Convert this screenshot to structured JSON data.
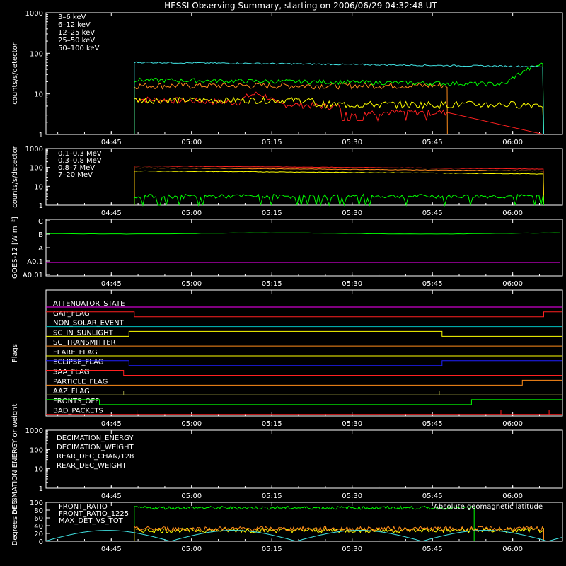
{
  "page": {
    "title": "HESSI Observing Summary, starting on 2006/06/29 04:32:48 UT"
  },
  "time_axis": {
    "range_minutes_after_0432": [
      0,
      96.5
    ],
    "ticks": [
      "04:45",
      "05:00",
      "05:15",
      "05:30",
      "05:45",
      "06:00"
    ],
    "tick_minutes": [
      12.2,
      27.2,
      42.2,
      57.2,
      72.2,
      87.2
    ]
  },
  "chart_data": [
    {
      "id": "hxr",
      "type": "line",
      "ylabel": "counts/s/detector",
      "yscale": "log",
      "ylim": [
        1,
        1000
      ],
      "yticks": [
        "1",
        "10",
        "100",
        "1000"
      ],
      "series": [
        {
          "name": "3–6 keV",
          "color": "#ff2020",
          "kind": "hxr_low"
        },
        {
          "name": "6–12 keV",
          "color": "#ff8c1a",
          "kind": "flat",
          "level": 16,
          "end": 75
        },
        {
          "name": "12–25 keV",
          "color": "#ffff00",
          "kind": "flat",
          "level": 7,
          "end": 93
        },
        {
          "name": "25–50 keV",
          "color": "#00ff00",
          "kind": "rise",
          "level": 22,
          "end": 93,
          "final": 60
        },
        {
          "name": "50–100 keV",
          "color": "#40e0e0",
          "kind": "decline",
          "level": 60,
          "final": 47,
          "end": 93
        }
      ],
      "data_start_minute": 16.5
    },
    {
      "id": "gamma",
      "type": "line",
      "ylabel": "counts/s/detector",
      "yscale": "log",
      "ylim": [
        1,
        1000
      ],
      "yticks": [
        "1",
        "10",
        "100",
        "1000"
      ],
      "series": [
        {
          "name": "0.1–0.3 MeV",
          "color": "#ff2020",
          "level": 120,
          "final": 82
        },
        {
          "name": "0.3–0.8 MeV",
          "color": "#ff8c1a",
          "level": 95,
          "final": 65
        },
        {
          "name": "0.8–7 MeV",
          "color": "#ffff00",
          "level": 65,
          "final": 45
        },
        {
          "name": "7–20 MeV",
          "color": "#00ff00",
          "level": 3,
          "final": 3
        }
      ],
      "data_start_minute": 16.5,
      "data_end_minute": 93
    },
    {
      "id": "goes",
      "type": "line",
      "ylabel": "GOES-12 [W m⁻²]",
      "yticks": [
        "C",
        "B",
        "A",
        "A0.1",
        "A0.01"
      ],
      "series": [
        {
          "name": "long",
          "color": "#00ff00",
          "level_class": 4.9
        },
        {
          "name": "short",
          "color": "#ff00ff",
          "level_class": 2.1
        }
      ]
    },
    {
      "id": "flags",
      "type": "line",
      "ylabel": "Flags",
      "series": [
        {
          "name": "ATTENUATOR_STATE",
          "color": "#ff00ff",
          "segments": [
            [
              0,
              96.5,
              0
            ]
          ]
        },
        {
          "name": "GAP_FLAG",
          "color": "#ff2020",
          "segments": [
            [
              0,
              16.5,
              1
            ],
            [
              16.5,
              93,
              0
            ],
            [
              93,
              96.5,
              1
            ]
          ]
        },
        {
          "name": "NON_SOLAR_EVENT",
          "color": "#00c0c0",
          "segments": [
            [
              0,
              96.5,
              0
            ]
          ]
        },
        {
          "name": "SC_IN_SUNLIGHT",
          "color": "#ffff00",
          "segments": [
            [
              0,
              15.5,
              0
            ],
            [
              15.5,
              74,
              1
            ],
            [
              74,
              96.5,
              0
            ]
          ]
        },
        {
          "name": "SC_TRANSMITTER",
          "color": "#ff8c1a",
          "segments": [
            [
              0,
              96.5,
              0
            ]
          ]
        },
        {
          "name": "FLARE_FLAG",
          "color": "#ffff00",
          "segments": [
            [
              0,
              96.5,
              0
            ]
          ]
        },
        {
          "name": "ECLIPSE_FLAG",
          "color": "#2020ff",
          "segments": [
            [
              0,
              15.5,
              1
            ],
            [
              15.5,
              74,
              0
            ],
            [
              74,
              96.5,
              1
            ]
          ]
        },
        {
          "name": "SAA_FLAG",
          "color": "#ff2020",
          "segments": [
            [
              0,
              14.5,
              1
            ],
            [
              14.5,
              96.5,
              0
            ]
          ]
        },
        {
          "name": "PARTICLE_FLAG",
          "color": "#ff8c1a",
          "segments": [
            [
              0,
              89,
              0
            ],
            [
              89,
              96.5,
              1
            ]
          ]
        },
        {
          "name": "AAZ_FLAG",
          "color": "#9a9a40",
          "segments": [
            [
              0,
              96.5,
              0
            ]
          ],
          "spikes": [
            14.5,
            73.5
          ]
        },
        {
          "name": "FRONTS_OFF",
          "color": "#00ff00",
          "segments": [
            [
              0,
              10,
              1
            ],
            [
              10,
              79.5,
              0
            ],
            [
              79.5,
              96.5,
              1
            ]
          ]
        },
        {
          "name": "BAD_PACKETS",
          "color": "#ff2020",
          "segments": [
            [
              0,
              96.5,
              0
            ]
          ],
          "spikes": [
            17,
            85,
            94
          ]
        }
      ]
    },
    {
      "id": "decimation",
      "type": "line",
      "ylabel": "DECIMATION ENERGY or weight",
      "yscale": "log",
      "ylim": [
        1,
        1000
      ],
      "yticks": [
        "1",
        "10",
        "100",
        "1000"
      ],
      "series": [
        {
          "name": "DECIMATION_ENERGY",
          "color": "#00ff00"
        },
        {
          "name": "DECIMATION_WEIGHT",
          "color": "#ff8c1a"
        },
        {
          "name": "REAR_DEC_CHAN/128",
          "color": "#40e0e0"
        },
        {
          "name": "REAR_DEC_WEIGHT",
          "color": "#9a9a40"
        }
      ]
    },
    {
      "id": "ratio",
      "type": "line",
      "ylabel": "Degrees or %",
      "ylim": [
        0,
        100
      ],
      "yticks": [
        "0",
        "20",
        "40",
        "60",
        "80",
        "100"
      ],
      "annotation": "Absolute geomagnetic latitude",
      "annotation_color": "#40e0e0",
      "series": [
        {
          "name": "FRONT_RATIO",
          "color": "#ffff00",
          "level": 28
        },
        {
          "name": "FRONT_RATIO_1225",
          "color": "#00ff00",
          "level": 86,
          "end": 80
        },
        {
          "name": "MAX_DET_VS_TOT",
          "color": "#ff8c1a",
          "level": 32,
          "end": 93
        },
        {
          "name": "Absolute geomagnetic latitude",
          "color": "#40e0e0",
          "kind": "latitude"
        }
      ]
    }
  ]
}
